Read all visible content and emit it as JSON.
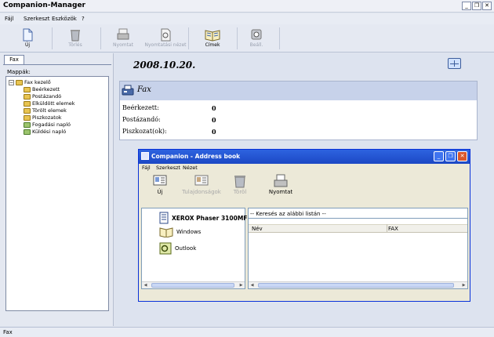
{
  "app": {
    "title": "Companion-Manager"
  },
  "window_controls": [
    "_",
    "❐",
    "✕"
  ],
  "menu": [
    "Fájl",
    "Szerkeszt",
    "Eszközök",
    "?"
  ],
  "toolbar": {
    "new": "Új",
    "delete": "Törlés",
    "print": "Nyomtat",
    "print_preview": "Nyomtatási nézet",
    "addresses": "Címek",
    "settings": "Beáll."
  },
  "left": {
    "tab": "Fax",
    "folders_label": "Mappák:",
    "tree": {
      "root": "Fax kezelő",
      "children": [
        "Beérkezett",
        "Postázandó",
        "Elküldött elemek",
        "Törölt elemek",
        "Piszkozatok",
        "Fogadási napló",
        "Küldési napló"
      ]
    }
  },
  "main": {
    "date": "2008.10.20.",
    "fax_panel": {
      "title": "Fax",
      "rows": [
        {
          "label": "Beérkezett:",
          "value": "0"
        },
        {
          "label": "Postázandó:",
          "value": "0"
        },
        {
          "label": "Piszkozat(ok):",
          "value": "0"
        }
      ]
    }
  },
  "dialog": {
    "title": "Companion - Address book",
    "menu": [
      "Fájl",
      "Szerkeszt",
      "Nézet"
    ],
    "toolbar": {
      "new": "Új",
      "properties": "Tulajdonságok",
      "delete": "Töröl",
      "print": "Nyomtat"
    },
    "sources": [
      "XEROX Phaser 3100MFP",
      "Windows",
      "Outlook"
    ],
    "search": "-- Keresés az alábbi listán --",
    "columns": [
      "Név",
      "FAX"
    ]
  },
  "status": {
    "text": "Fax"
  }
}
